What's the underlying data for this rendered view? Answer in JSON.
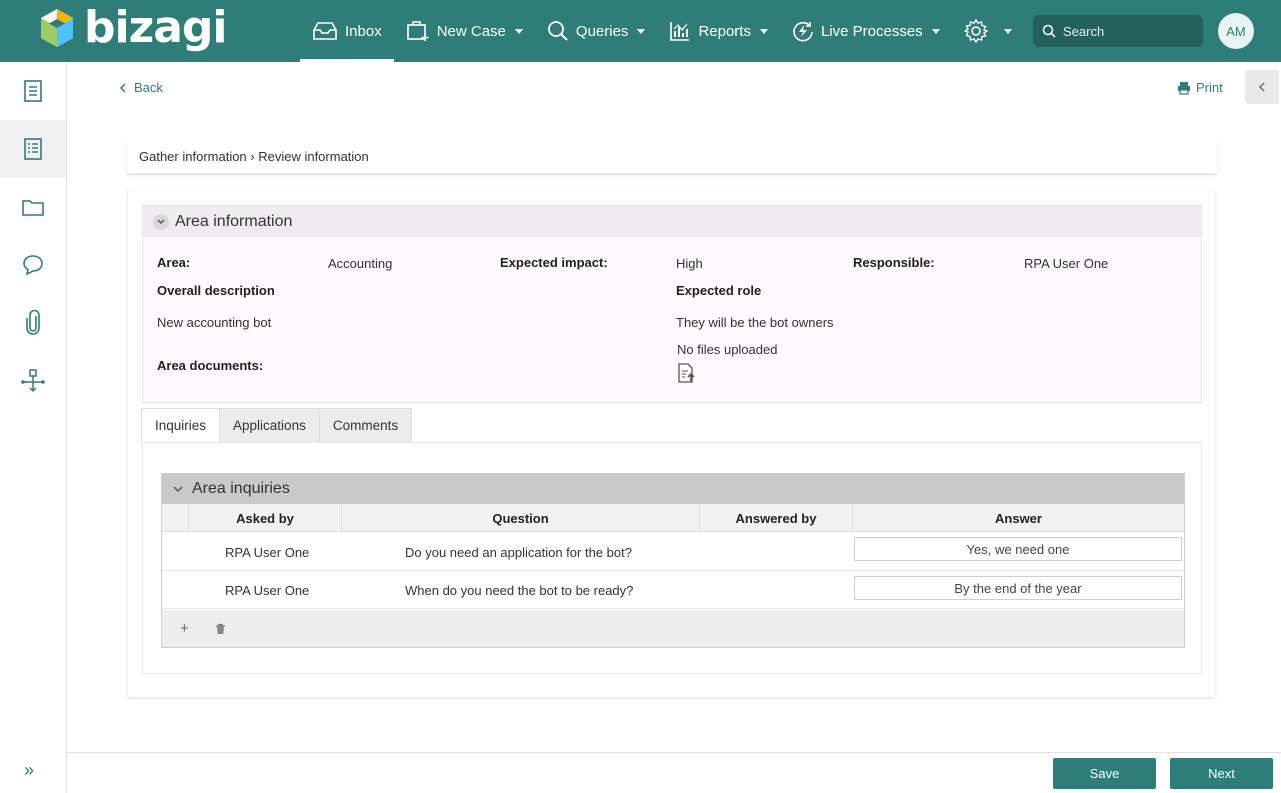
{
  "app": {
    "brand": "bizagi",
    "brand_color": "#2e7d78"
  },
  "nav": {
    "inbox": "Inbox",
    "new_case": "New Case",
    "queries": "Queries",
    "reports": "Reports",
    "live_processes": "Live Processes"
  },
  "search": {
    "placeholder": "Search"
  },
  "user": {
    "initials": "AM"
  },
  "toolbar": {
    "back": "Back",
    "print": "Print"
  },
  "breadcrumb": "Gather information › Review information",
  "area_info": {
    "title": "Area information",
    "area_label": "Area:",
    "area_value": "Accounting",
    "impact_label": "Expected impact:",
    "impact_value": "High",
    "responsible_label": "Responsible:",
    "responsible_value": "RPA User One",
    "overall_label": "Overall description",
    "overall_value": "New accounting bot",
    "role_label": "Expected role",
    "role_value": "They will be the bot owners",
    "docs_label": "Area documents:",
    "docs_value": "No files uploaded"
  },
  "tabs": [
    "Inquiries",
    "Applications",
    "Comments"
  ],
  "inquiries": {
    "title": "Area inquiries",
    "columns": [
      "Asked by",
      "Question",
      "Answered by",
      "Answer"
    ],
    "rows": [
      {
        "asked_by": "RPA User One",
        "question": "Do you need an application for the bot?",
        "answered_by": "",
        "answer": "Yes, we need one"
      },
      {
        "asked_by": "RPA User One",
        "question": "When do you need the bot to be ready?",
        "answered_by": "",
        "answer": "By the end of the year"
      }
    ]
  },
  "footer": {
    "save": "Save",
    "next": "Next"
  }
}
